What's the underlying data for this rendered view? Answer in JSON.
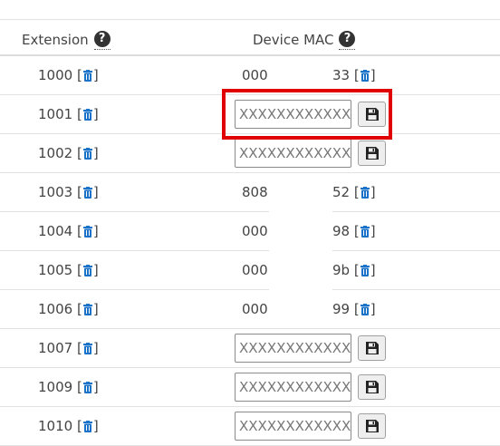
{
  "header": {
    "extension_label": "Extension",
    "device_mac_label": "Device MAC",
    "help_glyph": "?"
  },
  "rows": [
    {
      "extension": "1000",
      "mac_left": "000",
      "mac_right": "33",
      "has_input": false
    },
    {
      "extension": "1001",
      "placeholder": "XXXXXXXXXXXX",
      "has_input": true,
      "highlighted": true
    },
    {
      "extension": "1002",
      "placeholder": "XXXXXXXXXXXX",
      "has_input": true
    },
    {
      "extension": "1003",
      "mac_left": "808",
      "mac_right": "52",
      "has_input": false
    },
    {
      "extension": "1004",
      "mac_left": "000",
      "mac_right": "98",
      "has_input": false
    },
    {
      "extension": "1005",
      "mac_left": "000",
      "mac_right": "9b",
      "has_input": false
    },
    {
      "extension": "1006",
      "mac_left": "000",
      "mac_right": "99",
      "has_input": false
    },
    {
      "extension": "1007",
      "placeholder": "XXXXXXXXXXXX",
      "has_input": true
    },
    {
      "extension": "1009",
      "placeholder": "XXXXXXXXXXXX",
      "has_input": true
    },
    {
      "extension": "1010",
      "placeholder": "XXXXXXXXXXXX",
      "has_input": true
    }
  ],
  "icons": {
    "delete": "trash-icon",
    "save": "floppy-disk-icon",
    "help": "question-circle-icon"
  },
  "colors": {
    "trash_blue": "#1a73c8",
    "highlight_red": "#e00000"
  }
}
